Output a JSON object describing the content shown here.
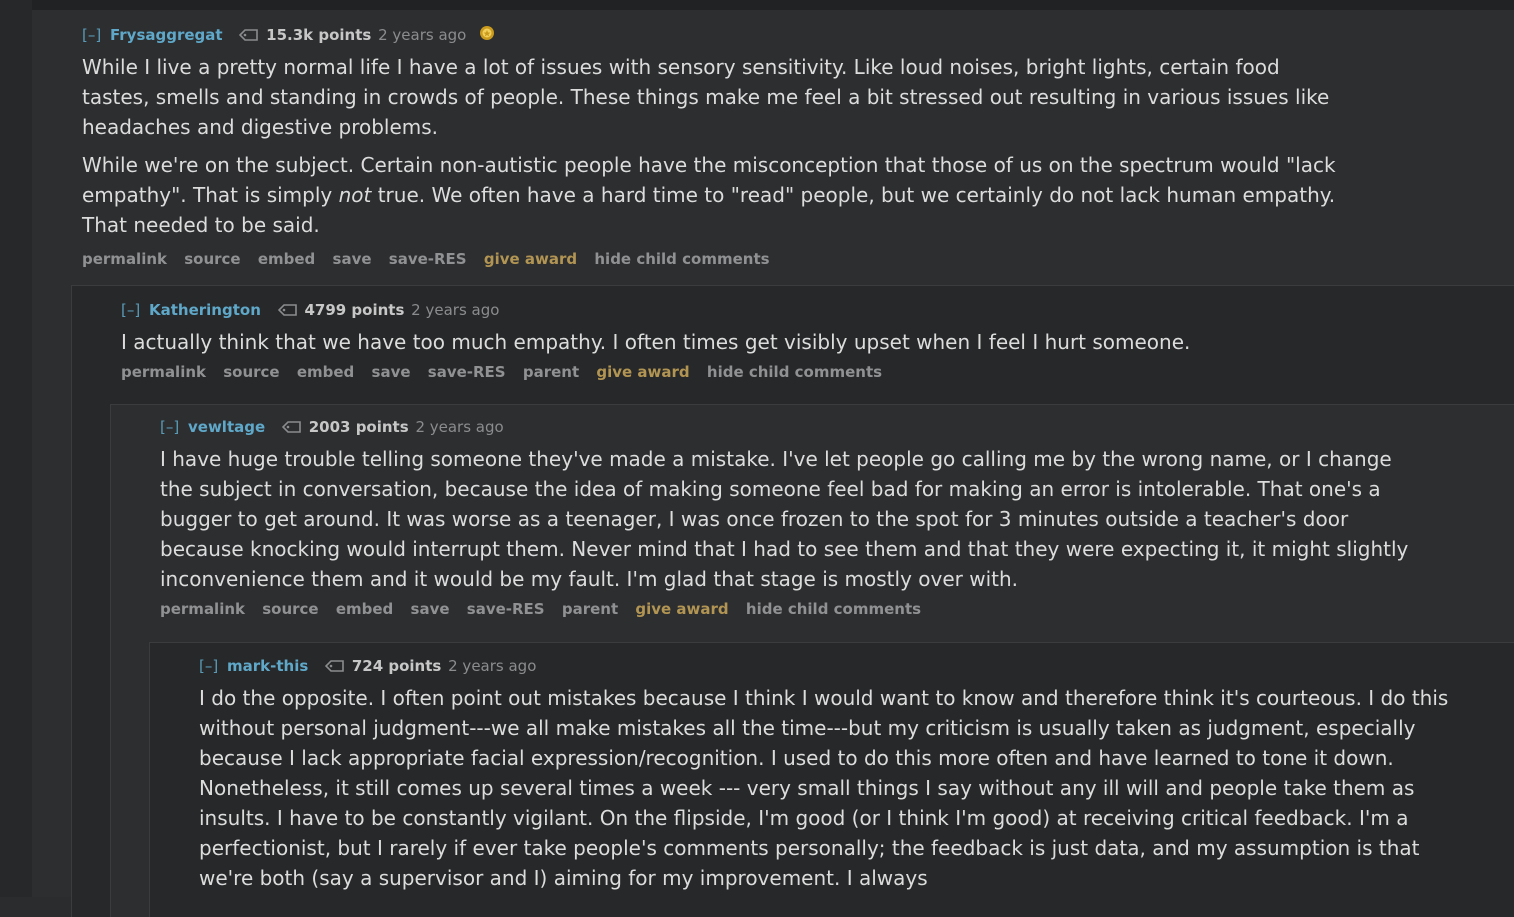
{
  "comments": [
    {
      "expand": "[–]",
      "author": "Frysaggregat",
      "points": "15.3k points",
      "time": "2 years ago",
      "paragraphs": [
        "While I live a pretty normal life I have a lot of issues with sensory sensitivity. Like loud noises, bright lights, certain food tastes, smells and standing in crowds of people. These things make me feel a bit stressed out resulting in various issues like headaches and digestive problems."
      ],
      "p2_before": "While we're on the subject. Certain non-autistic people have the misconception that those of us on the spectrum would \"lack empathy\". That is simply ",
      "p2_em": "not",
      "p2_after": " true. We often have a hard time to \"read\" people, but we certainly do not lack human empathy. That needed to be said.",
      "buttons": [
        "permalink",
        "source",
        "embed",
        "save",
        "save-RES",
        "give award",
        "hide child comments"
      ]
    },
    {
      "expand": "[–]",
      "author": "Katherington",
      "points": "4799 points",
      "time": "2 years ago",
      "text": "I actually think that we have too much empathy. I often times get visibly upset when I feel I hurt someone.",
      "buttons": [
        "permalink",
        "source",
        "embed",
        "save",
        "save-RES",
        "parent",
        "give award",
        "hide child comments"
      ]
    },
    {
      "expand": "[–]",
      "author": "vewltage",
      "points": "2003 points",
      "time": "2 years ago",
      "text": "I have huge trouble telling someone they've made a mistake. I've let people go calling me by the wrong name, or I change the subject in conversation, because the idea of making someone feel bad for making an error is intolerable. That one's a bugger to get around. It was worse as a teenager, I was once frozen to the spot for 3 minutes outside a teacher's door because knocking would interrupt them. Never mind that I had to see them and that they were expecting it, it might slightly inconvenience them and it would be my fault. I'm glad that stage is mostly over with.",
      "buttons": [
        "permalink",
        "source",
        "embed",
        "save",
        "save-RES",
        "parent",
        "give award",
        "hide child comments"
      ]
    },
    {
      "expand": "[–]",
      "author": "mark-this",
      "points": "724 points",
      "time": "2 years ago",
      "text": "I do the opposite. I often point out mistakes because I think I would want to know and therefore think it's courteous. I do this without personal judgment---we all make mistakes all the time---but my criticism is usually taken as judgment, especially because I lack appropriate facial expression/recognition. I used to do this more often and have learned to tone it down. Nonetheless, it still comes up several times a week --- very small things I say without any ill will and people take them as insults. I have to be constantly vigilant. On the flipside, I'm good (or I think I'm good) at receiving critical feedback. I'm a perfectionist, but I rarely if ever take people's comments personally; the feedback is just data, and my assumption is that we're both (say a supervisor and I) aiming for my improvement. I always"
    }
  ],
  "colors": {
    "author": "#5fa8c9",
    "award_link": "#b39553",
    "background": "#2c2e30"
  },
  "icons": {
    "score": "tag-icon",
    "award": "gold-award-icon"
  }
}
